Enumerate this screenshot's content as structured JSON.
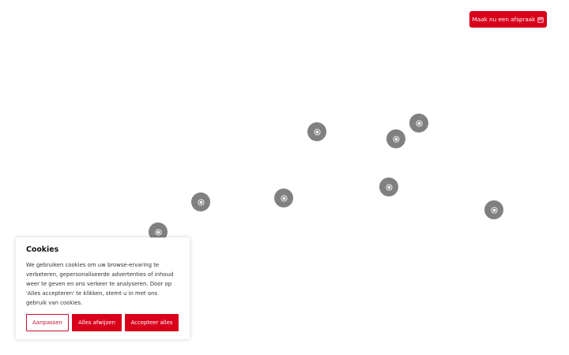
{
  "header": {
    "cta_label": "Maak nu een afspraak",
    "cta_icon": "calendar-icon"
  },
  "hotspots": {
    "icon": "target-icon",
    "count": 8
  },
  "cookie_banner": {
    "title": "Cookies",
    "text": "We gebruiken cookies om uw browse-ervaring te verbeteren, gepersonaliseerde advertenties of inhoud weer te geven en ons verkeer te analyseren. Door op 'Alles accepteren' te klikken, stemt u in met ons gebruik van cookies.",
    "customize_label": "Aanpassen",
    "reject_label": "Alles afwijzen",
    "accept_label": "Accepteer alles"
  },
  "colors": {
    "accent": "#d9001b",
    "hotspot": "#808080",
    "background": "#ffffff"
  }
}
